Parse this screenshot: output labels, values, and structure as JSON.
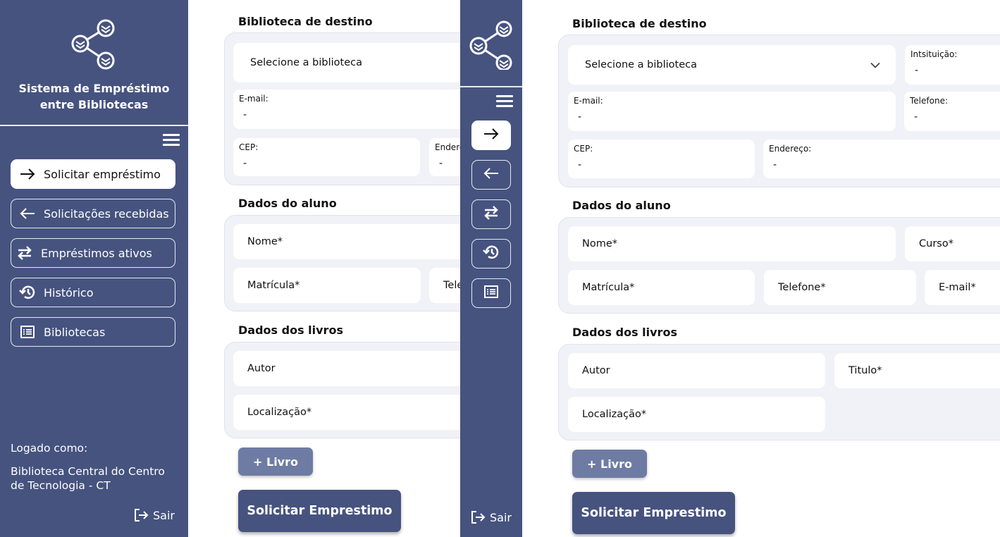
{
  "app": {
    "brand_line1": "Sistema de Empréstimo",
    "brand_line2": "entre Bibliotecas",
    "colors": {
      "sidebar": "#46537f",
      "group_bg": "#f0f2f7",
      "add_button": "#6e7ca4"
    }
  },
  "nav": {
    "items": [
      {
        "label": "Solicitar empréstimo",
        "icon": "arrow-right-icon",
        "active": true
      },
      {
        "label": "Solicitações recebidas",
        "icon": "arrow-left-icon",
        "active": false
      },
      {
        "label": "Empréstimos ativos",
        "icon": "swap-arrows-icon",
        "active": false
      },
      {
        "label": "Histórico",
        "icon": "history-icon",
        "active": false
      },
      {
        "label": "Bibliotecas",
        "icon": "list-icon",
        "active": false
      }
    ]
  },
  "user": {
    "logged_label": "Logado como:",
    "name": "Biblioteca Central do Centro de Tecnologia - CT",
    "logout": "Sair"
  },
  "form": {
    "library_section": {
      "title": "Biblioteca de destino",
      "select_placeholder": "Selecione a biblioteca",
      "institution_label": "Intsituição:",
      "institution_value": "-",
      "email_label": "E-mail:",
      "email_value": "-",
      "phone_label": "Telefone:",
      "phone_value": "-",
      "cep_label": "CEP:",
      "cep_value": "-",
      "address_label": "Endereço:",
      "address_label_cut": "Endere",
      "address_value": "-"
    },
    "student_section": {
      "title": "Dados do aluno",
      "name": "Nome*",
      "course": "Curso*",
      "registration": "Matrícula*",
      "phone": "Telefone*",
      "phone_cut": "Tele",
      "email": "E-mail*"
    },
    "books_section": {
      "title": "Dados dos livros",
      "author": "Autor",
      "title_field": "Titulo*",
      "location": "Localização*"
    },
    "add_book_label": "+  Livro",
    "submit_label": "Solicitar Emprestimo"
  }
}
